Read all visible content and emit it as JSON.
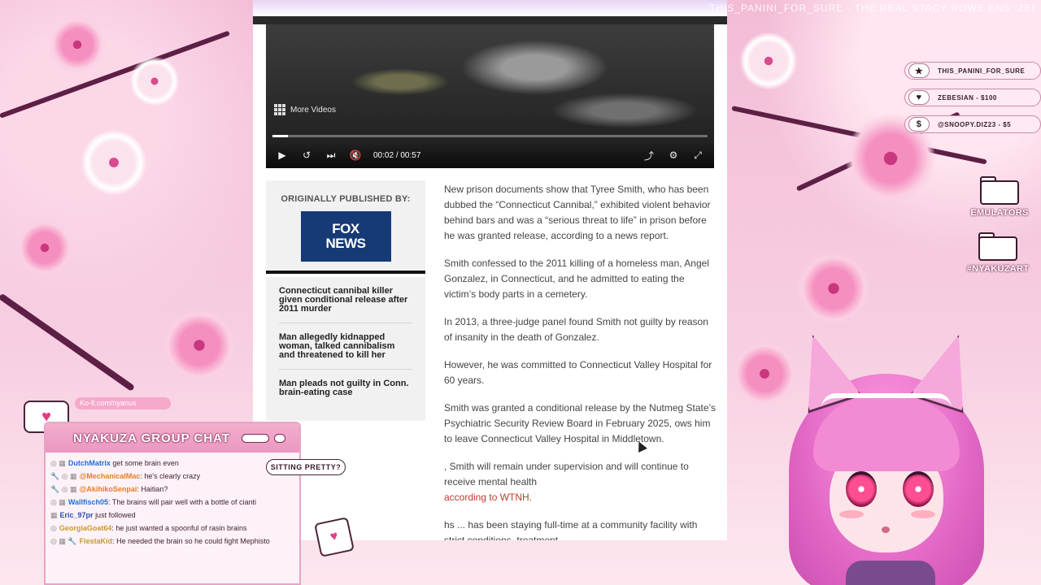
{
  "ticker": {
    "text": "THIS_PANINI_FOR_SURE · THE REAL STACY ROWE ENS: ZEBE…"
  },
  "alerts": [
    {
      "icon": "★",
      "icon_name": "star-icon",
      "text": "THIS_PANINI_FOR_SURE"
    },
    {
      "icon": "♥",
      "icon_name": "heart-icon",
      "text": "ZEBESIAN - $100"
    },
    {
      "icon": "$",
      "icon_name": "dollar-icon",
      "text": "@SNOOPY.DIZ23 - $5"
    }
  ],
  "folders": [
    {
      "label": "EMULATORS"
    },
    {
      "label": "#NYAKUZART"
    }
  ],
  "video": {
    "more_label": "More Videos",
    "time_current": "00:02",
    "time_separator": "/",
    "time_total": "00:57",
    "progress_fraction": 0.035
  },
  "sidebar": {
    "published_label": "ORIGINALLY PUBLISHED BY:",
    "logo_line1": "FOX",
    "logo_line2": "NEWS",
    "related": [
      {
        "title": "Connecticut cannibal killer given conditional release after 2011 murder"
      },
      {
        "title": "Man allegedly kidnapped woman, talked cannibalism and threatened to kill her"
      },
      {
        "title": "Man pleads not guilty in Conn. brain-eating case"
      }
    ]
  },
  "article": {
    "paragraphs": [
      "New prison documents show that Tyree Smith, who has been dubbed the “Connecticut Cannibal,” exhibited violent behavior behind bars and was a “serious threat to life” in prison before he was granted release, according to a news report.",
      "Smith confessed to the 2011 killing of a homeless man, Angel Gonzalez, in Connecticut, and he admitted to eating the victim’s body parts in a cemetery.",
      "In 2013, a three-judge panel found Smith not guilty by reason of insanity in the death of Gonzalez.",
      "However, he was committed to Connecticut Valley Hospital for 60 years.",
      "Smith was granted a conditional release by the Nutmeg State’s Psychiatric Security Review Board in February 2025, ows him to leave Connecticut Valley Hospital in Middletown."
    ],
    "para6_text": ", Smith will remain under supervision and will continue to receive mental health",
    "para6_link": "according to WTNH.",
    "para7_text": "hs ... has been staying full-time at a community facility with strict conditions, treatment"
  },
  "chat": {
    "kofi": "Ko-fi.com/nyanus",
    "title": "NYAKUZA GROUP CHAT",
    "bubble": "SITTING PRETTY?",
    "messages": [
      {
        "user": "DutchMatrix",
        "text": "get some brain even"
      },
      {
        "user": "@MechanicalMac",
        "text": "he's clearly crazy"
      },
      {
        "user": "@AkihikoSenpai",
        "text": "Haitian?"
      },
      {
        "user": "Wallfisch05",
        "text": "The brains will pair well with a bottle of cianti"
      },
      {
        "user": "Eric_97pr",
        "text": "just followed"
      },
      {
        "user": "GeorgiaGoat64",
        "text": "he just wanted a spoonful of rasin brains"
      },
      {
        "user": "FiestaKid",
        "text": "He needed the brain so he could fight Mephisto"
      }
    ]
  }
}
